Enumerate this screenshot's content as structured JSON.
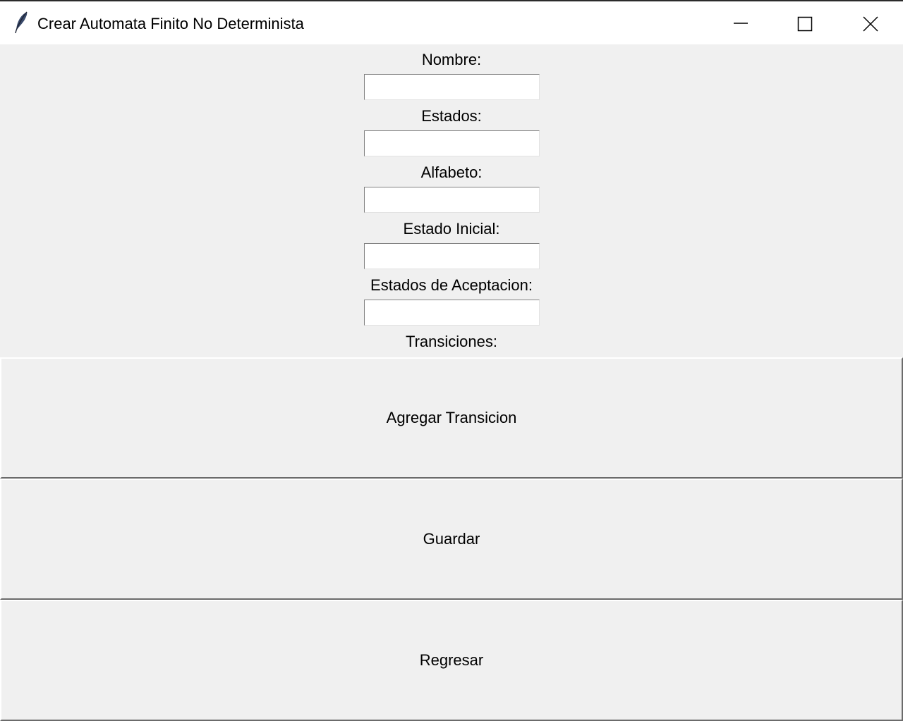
{
  "window": {
    "title": "Crear Automata Finito No Determinista",
    "app_icon": "feather-icon",
    "controls": [
      "minimize-icon",
      "maximize-icon",
      "close-icon"
    ]
  },
  "form": {
    "fields": [
      {
        "label": "Nombre:",
        "value": ""
      },
      {
        "label": "Estados:",
        "value": ""
      },
      {
        "label": "Alfabeto:",
        "value": ""
      },
      {
        "label": "Estado Inicial:",
        "value": ""
      },
      {
        "label": "Estados de Aceptacion:",
        "value": ""
      }
    ],
    "transitions_label": "Transiciones:"
  },
  "buttons": {
    "add_transition": "Agregar Transicion",
    "save": "Guardar",
    "back": "Regresar"
  }
}
